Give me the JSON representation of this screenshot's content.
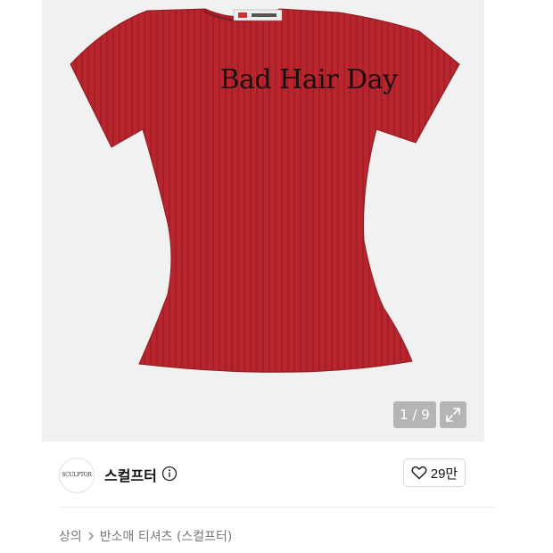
{
  "product_image": {
    "print_text": "Bad Hair Day",
    "counter": "1 / 9",
    "expand_icon": "expand-icon"
  },
  "brand": {
    "logo_text": "SCULPTOR",
    "name": "스컬프터",
    "info_icon": "info-icon"
  },
  "like": {
    "icon": "heart-icon",
    "count": "29만"
  },
  "breadcrumb": {
    "items": [
      "상의",
      "반소매 티셔츠 (스컬프터)"
    ],
    "separator_icon": "chevron-right-icon"
  },
  "colors": {
    "shirt": "#b5262e",
    "background": "#f1f1f1"
  }
}
